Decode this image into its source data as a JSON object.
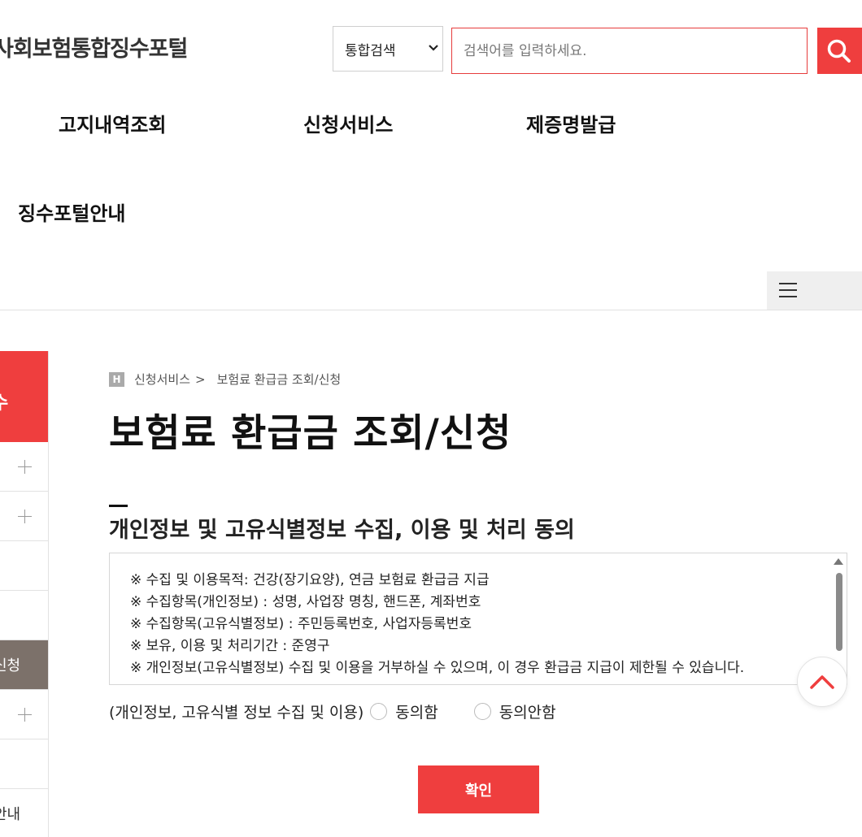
{
  "header": {
    "logo_text": "사회보험통합징수포털",
    "search": {
      "scope_selected": "통합검색",
      "placeholder": "검색어를 입력하세요."
    }
  },
  "gnb": {
    "items": [
      {
        "label": "고지내역조회"
      },
      {
        "label": "신청서비스"
      },
      {
        "label": "제증명발급"
      },
      {
        "label": "징수포털안내"
      }
    ]
  },
  "icons": {
    "search": "search-icon",
    "menu": "hamburger-menu-icon",
    "plus": "plus-icon",
    "home": "home-icon",
    "top": "chevron-up-icon"
  },
  "lnb": {
    "head_label_partial": "수",
    "active_label_partial": "신청",
    "bottom_label_partial": "안내"
  },
  "breadcrumb": {
    "home_mark": "H",
    "items": [
      "신청서비스",
      "보험료 환급금 조회/신청"
    ],
    "separator": ">"
  },
  "page": {
    "title": "보험료 환급금 조회/신청",
    "section_title": "개인정보 및 고유식별정보 수집, 이용 및 처리 동의",
    "agreement_lines": [
      "※ 수집 및 이용목적: 건강(장기요양), 연금 보험료 환급금 지급",
      "※ 수집항목(개인정보) : 성명, 사업장 명칭, 핸드폰, 계좌번호",
      "※ 수집항목(고유식별정보) : 주민등록번호, 사업자등록번호",
      "※ 보유, 이용 및 처리기간 : 준영구",
      "※ 개인정보(고유식별정보) 수집 및 이용을 거부하실 수 있으며, 이 경우 환급금 지급이 제한될 수 있습니다."
    ],
    "consent_label": "(개인정보, 고유식별 정보 수집 및 이용)",
    "consent_agree": "동의함",
    "consent_disagree": "동의안함",
    "confirm_button": "확인"
  },
  "colors": {
    "accent": "#ef3e3e",
    "lnb_active": "#7c716a",
    "menu_bg": "#efefef"
  }
}
